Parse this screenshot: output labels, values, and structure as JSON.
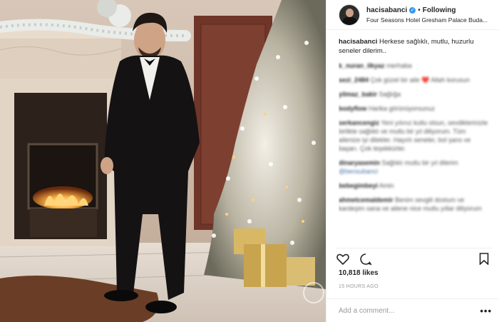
{
  "post": {
    "username": "hacisabanci",
    "verified_icon": "verified-badge-icon",
    "separator": "•",
    "follow_status": "Following",
    "location": "Four Seasons Hotel Gresham Palace Buda...",
    "caption_user": "hacisabanci",
    "caption_text": "Herkese sağlıklı, mutlu, huzurlu seneler dilerim..",
    "likes": "10,818 likes",
    "timestamp": "15 HOURS AGO",
    "add_comment_placeholder": "Add a comment...",
    "more_label": "•••"
  },
  "comments": [
    {
      "user": "k_nuran_ilkyaz",
      "text": "merhaba"
    },
    {
      "user": "sezi_2484",
      "text": "Çok güzel bir aile ❤️ Allah korusun"
    },
    {
      "user": "yilmaz_bakir",
      "text": "Sağlığa"
    },
    {
      "user": "bodyflow",
      "text": "Harika görünüyorsunuz"
    },
    {
      "user": "serkancengiz",
      "text": "Yeni yılınız kutlu olsun, sevdiklerinizle birlikte sağlıklı ve mutlu bir yıl diliyorum. Tüm ailenize iyi dilekler. Hayırlı seneler, bol şans ve başarı. Çok teşekkürler."
    },
    {
      "user": "dinaryasemin",
      "text": "Sağlıklı mutlu bir yıl dilerim",
      "tag": "@bensubanci"
    },
    {
      "user": "bebegimbeyi",
      "text": "Amin"
    },
    {
      "user": "ahmetcemaldemir",
      "text": "Benim sevgili dostum ve kardeşim sana ve ailene nice mutlu yıllar diliyorum"
    }
  ],
  "colors": {
    "verified": "#3897f0",
    "muted": "#999999",
    "text": "#262626"
  }
}
